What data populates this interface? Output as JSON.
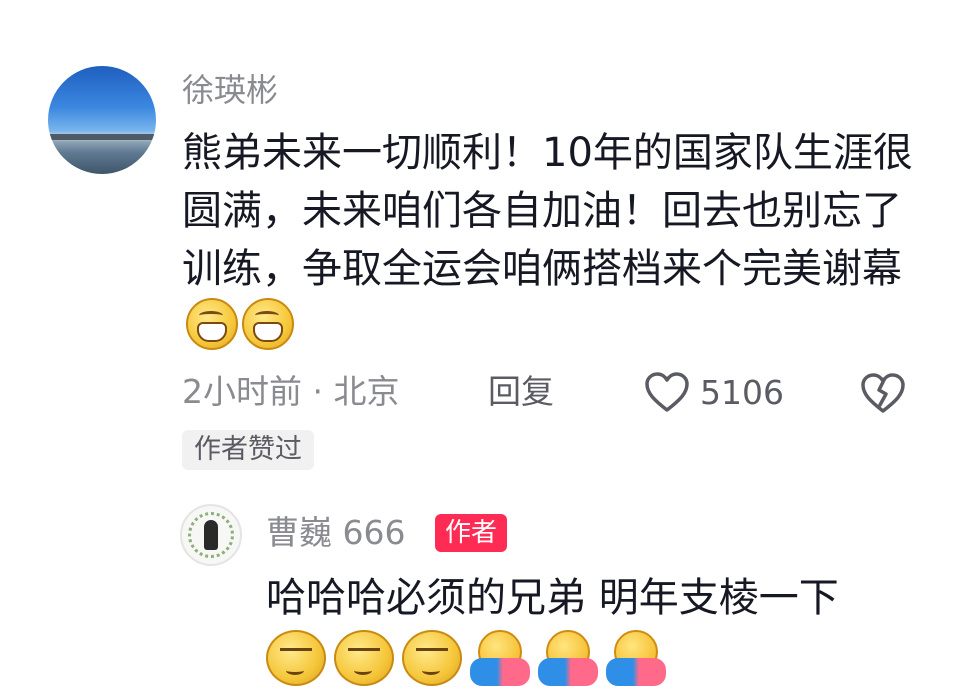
{
  "comment": {
    "username": "徐瑛彬",
    "text": "熊弟未来一切顺利！10年的国家队生涯很圆满，未来咱们各自加油！回去也别忘了训练，争取全运会咱俩搭档来个完美谢幕",
    "trailing_emojis": [
      "grin-emoji",
      "grin-emoji"
    ],
    "meta": "2小时前 · 北京",
    "reply_label": "回复",
    "like_count": "5106",
    "author_liked_badge": "作者赞过"
  },
  "reply": {
    "username": "曹巍 666",
    "author_tag": "作者",
    "text": "哈哈哈必须的兄弟 明年支棱一下",
    "emojis": [
      "smirk-emoji",
      "smirk-emoji",
      "smirk-emoji",
      "hug-emoji",
      "hug-emoji",
      "hug-emoji"
    ]
  },
  "colors": {
    "accent": "#fe2c55",
    "secondary_text": "#8a8b91",
    "primary_text": "#161823"
  }
}
